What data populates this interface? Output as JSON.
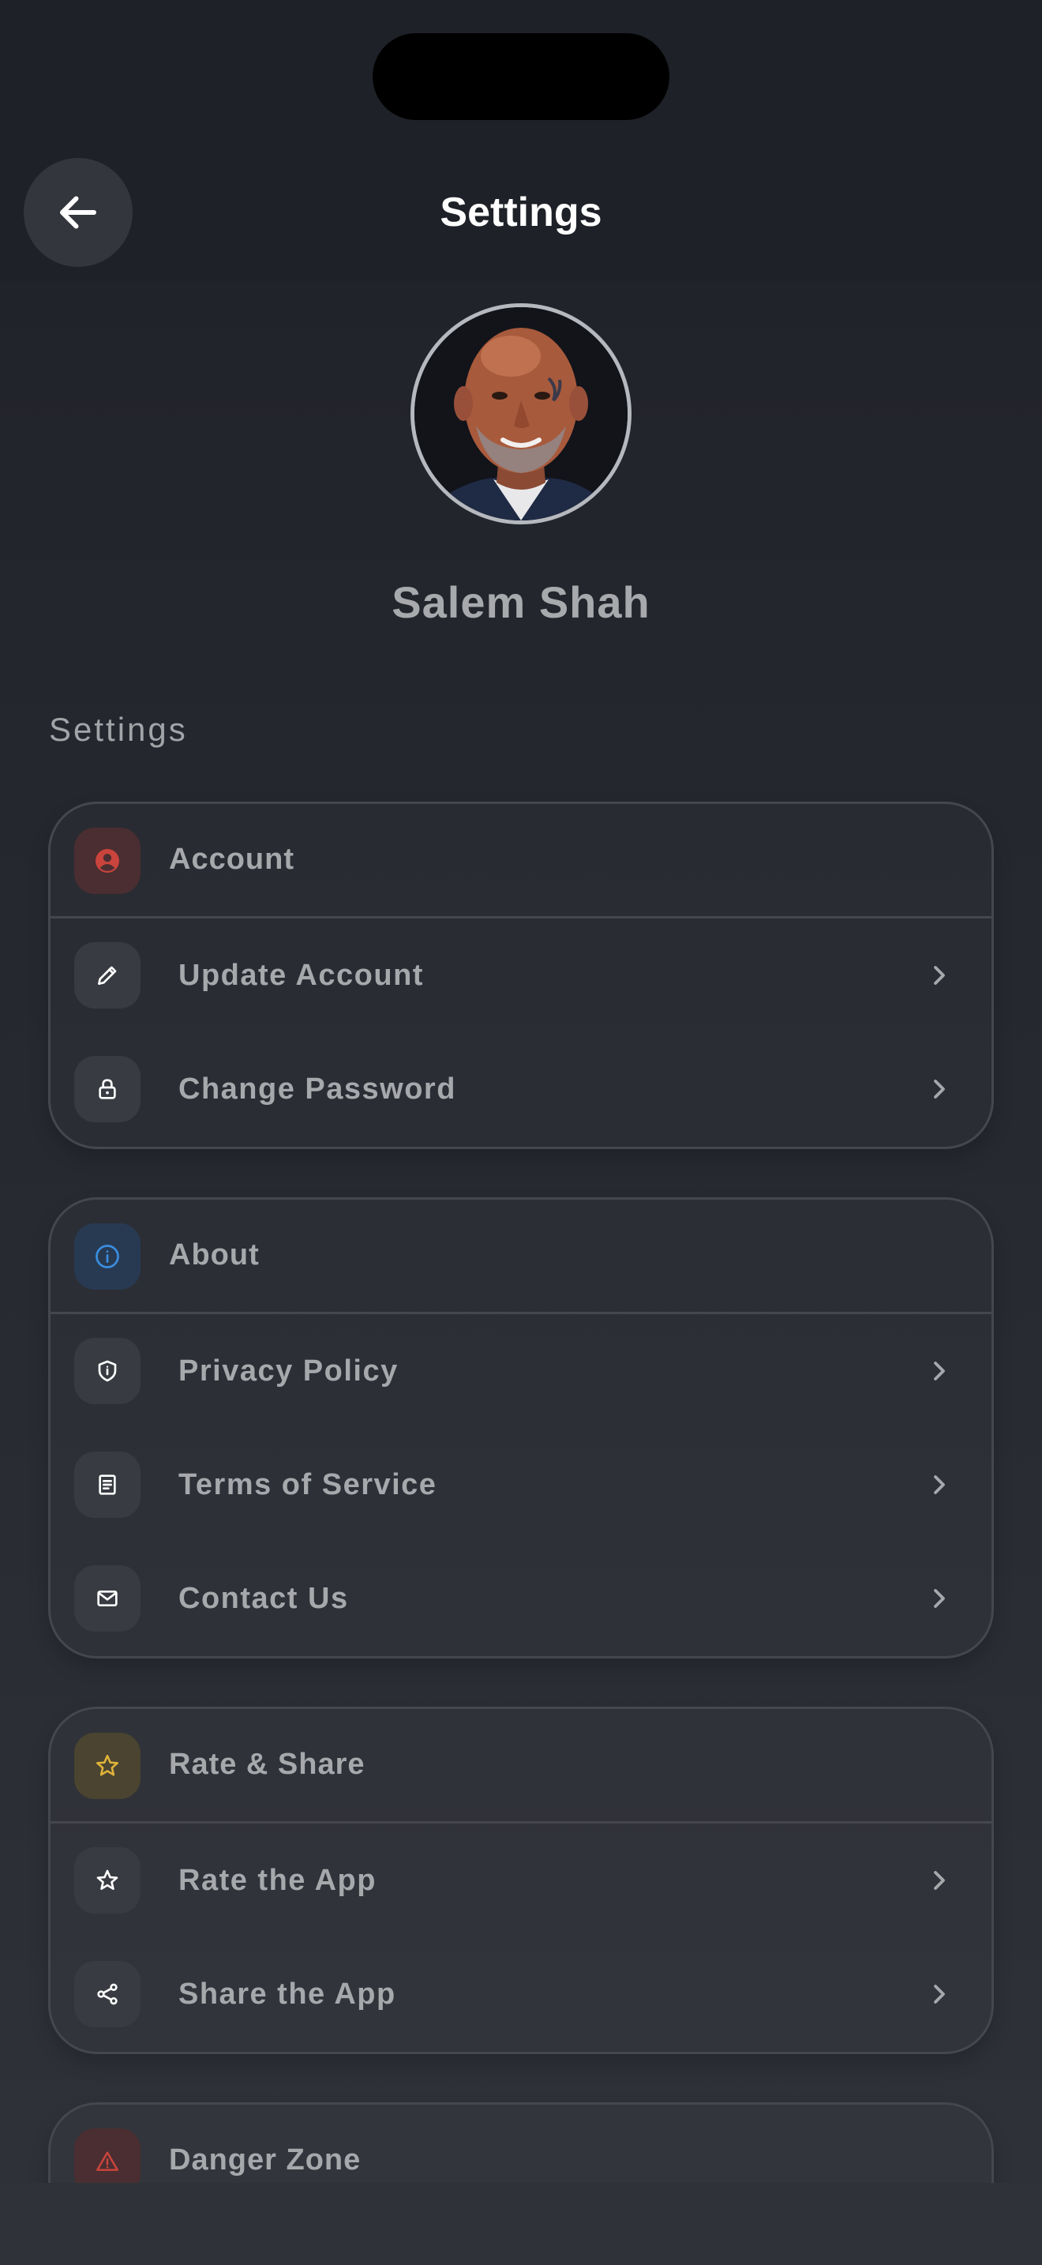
{
  "header": {
    "title": "Settings",
    "back_icon": "arrow-left-icon"
  },
  "profile": {
    "name": "Salem Shah",
    "avatar_icon": "avatar-photo"
  },
  "section_heading": "Settings",
  "colors": {
    "background": "#22252b",
    "card_border": "#44474d",
    "account_accent": "#c9443c",
    "about_accent": "#3a8ee0",
    "rate_accent": "#e0b43a",
    "danger_accent": "#c9443c"
  },
  "groups": [
    {
      "title": "Account",
      "icon": "user-circle-icon",
      "items": [
        {
          "label": "Update Account",
          "icon": "pencil-icon"
        },
        {
          "label": "Change Password",
          "icon": "lock-icon"
        }
      ]
    },
    {
      "title": "About",
      "icon": "info-icon",
      "items": [
        {
          "label": "Privacy Policy",
          "icon": "shield-icon"
        },
        {
          "label": "Terms of Service",
          "icon": "document-icon"
        },
        {
          "label": "Contact Us",
          "icon": "mail-icon"
        }
      ]
    },
    {
      "title": "Rate & Share",
      "icon": "star-outline-icon",
      "items": [
        {
          "label": "Rate the App",
          "icon": "star-icon"
        },
        {
          "label": "Share the App",
          "icon": "share-icon"
        }
      ]
    },
    {
      "title": "Danger Zone",
      "icon": "warning-icon",
      "items": []
    }
  ]
}
